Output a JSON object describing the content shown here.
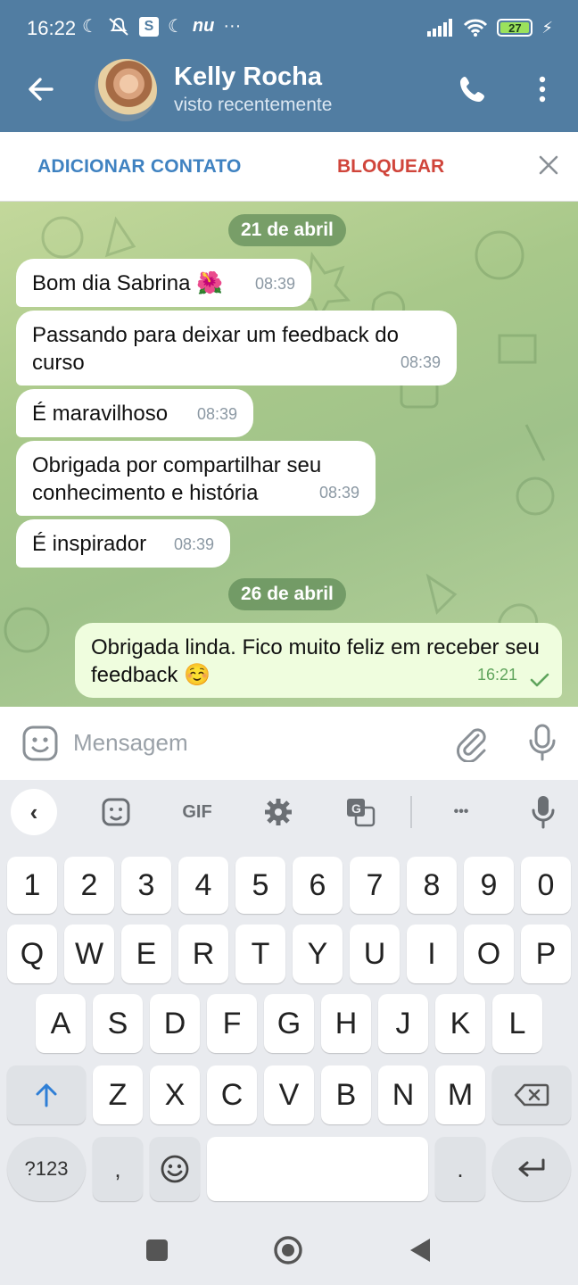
{
  "status_bar": {
    "time": "16:22",
    "left_icons": [
      "moon-icon",
      "muted-icon",
      "s-icon",
      "moon-icon",
      "nu-icon",
      "more-icon"
    ],
    "s_label": "S",
    "nu_label": "nu",
    "battery": "27"
  },
  "header": {
    "name": "Kelly Rocha",
    "status": "visto recentemente"
  },
  "actions": {
    "add_contact": "ADICIONAR CONTATO",
    "block": "BLOQUEAR"
  },
  "chat": {
    "date1": "21 de abril",
    "date2": "26 de abril",
    "messages": [
      {
        "text": "Bom dia Sabrina 🌺",
        "time": "08:39"
      },
      {
        "text": "Passando para deixar um feedback do curso",
        "time": "08:39"
      },
      {
        "text": "É maravilhoso",
        "time": "08:39"
      },
      {
        "text": "Obrigada por compartilhar seu conhecimento e história",
        "time": "08:39"
      },
      {
        "text": "É inspirador",
        "time": "08:39"
      },
      {
        "text": "Obrigada linda. Fico muito feliz em receber seu feedback ☺️",
        "time": "16:21"
      }
    ]
  },
  "input": {
    "placeholder": "Mensagem"
  },
  "keyboard": {
    "toolbar": {
      "gif": "GIF",
      "more": "•••"
    },
    "row_numbers": [
      "1",
      "2",
      "3",
      "4",
      "5",
      "6",
      "7",
      "8",
      "9",
      "0"
    ],
    "row1": [
      "Q",
      "W",
      "E",
      "R",
      "T",
      "Y",
      "U",
      "I",
      "O",
      "P"
    ],
    "row2": [
      "A",
      "S",
      "D",
      "F",
      "G",
      "H",
      "J",
      "K",
      "L"
    ],
    "row3": [
      "Z",
      "X",
      "C",
      "V",
      "B",
      "N",
      "M"
    ],
    "bottom": {
      "symbols": "?123",
      "comma": ",",
      "period": "."
    }
  },
  "colors": {
    "header": "#517da2",
    "accent_blue": "#3f82c1",
    "block_red": "#d0453b",
    "out_bubble": "#effdde"
  }
}
